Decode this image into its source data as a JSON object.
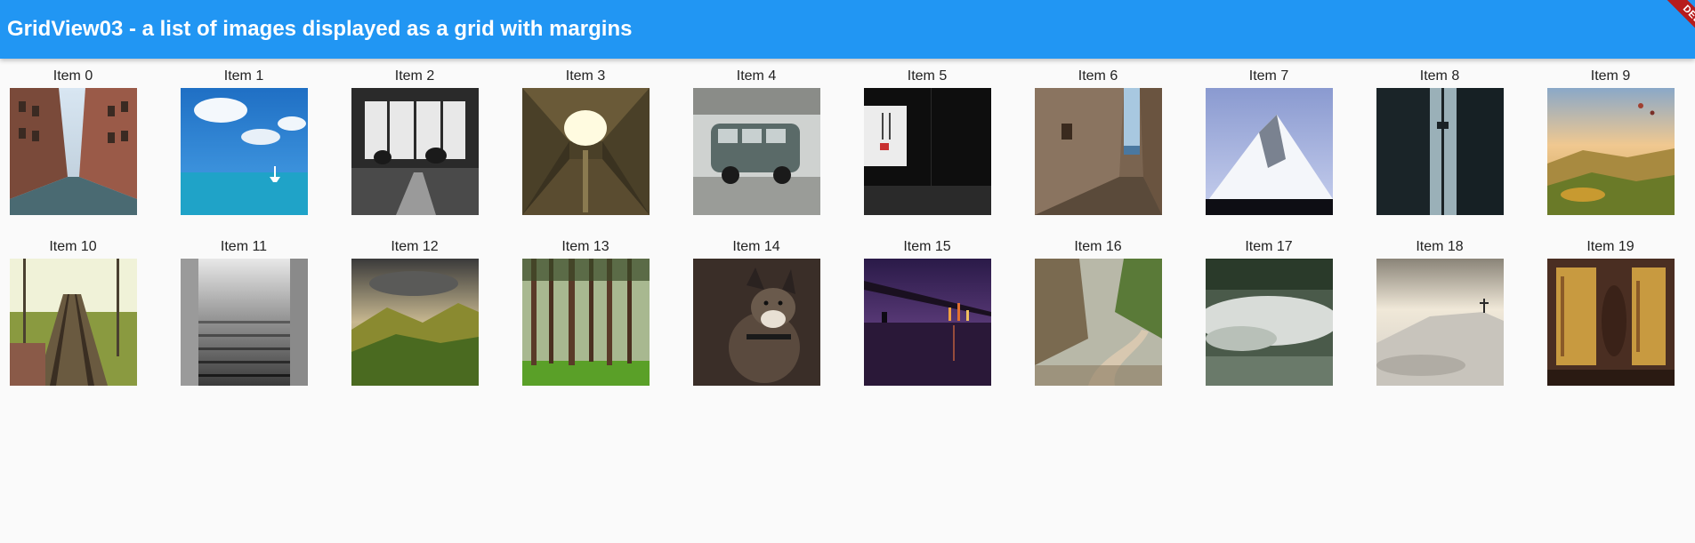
{
  "app": {
    "title": "GridView03 - a list of images displayed as a grid with margins",
    "debug_banner": "DEBUG",
    "colors": {
      "appbar": "#2196f3",
      "background": "#fafafa",
      "debug_ribbon": "#b71c1c"
    }
  },
  "grid": {
    "items": [
      {
        "label": "Item 0",
        "image_name": "city-street-image"
      },
      {
        "label": "Item 1",
        "image_name": "ocean-sky-boat-image"
      },
      {
        "label": "Item 2",
        "image_name": "cafe-window-bw-image"
      },
      {
        "label": "Item 3",
        "image_name": "building-lookup-image"
      },
      {
        "label": "Item 4",
        "image_name": "vw-van-image"
      },
      {
        "label": "Item 5",
        "image_name": "lantern-dark-image"
      },
      {
        "label": "Item 6",
        "image_name": "alley-sea-image"
      },
      {
        "label": "Item 7",
        "image_name": "matterhorn-image"
      },
      {
        "label": "Item 8",
        "image_name": "cn-tower-image"
      },
      {
        "label": "Item 9",
        "image_name": "balloons-valley-image"
      },
      {
        "label": "Item 10",
        "image_name": "railway-track-image"
      },
      {
        "label": "Item 11",
        "image_name": "misty-stairs-image"
      },
      {
        "label": "Item 12",
        "image_name": "green-valley-image"
      },
      {
        "label": "Item 13",
        "image_name": "pine-forest-image"
      },
      {
        "label": "Item 14",
        "image_name": "husky-dog-image"
      },
      {
        "label": "Item 15",
        "image_name": "bridge-night-image"
      },
      {
        "label": "Item 16",
        "image_name": "country-road-image"
      },
      {
        "label": "Item 17",
        "image_name": "foggy-forest-image"
      },
      {
        "label": "Item 18",
        "image_name": "snowy-hill-image"
      },
      {
        "label": "Item 19",
        "image_name": "rusty-wall-image"
      }
    ]
  }
}
